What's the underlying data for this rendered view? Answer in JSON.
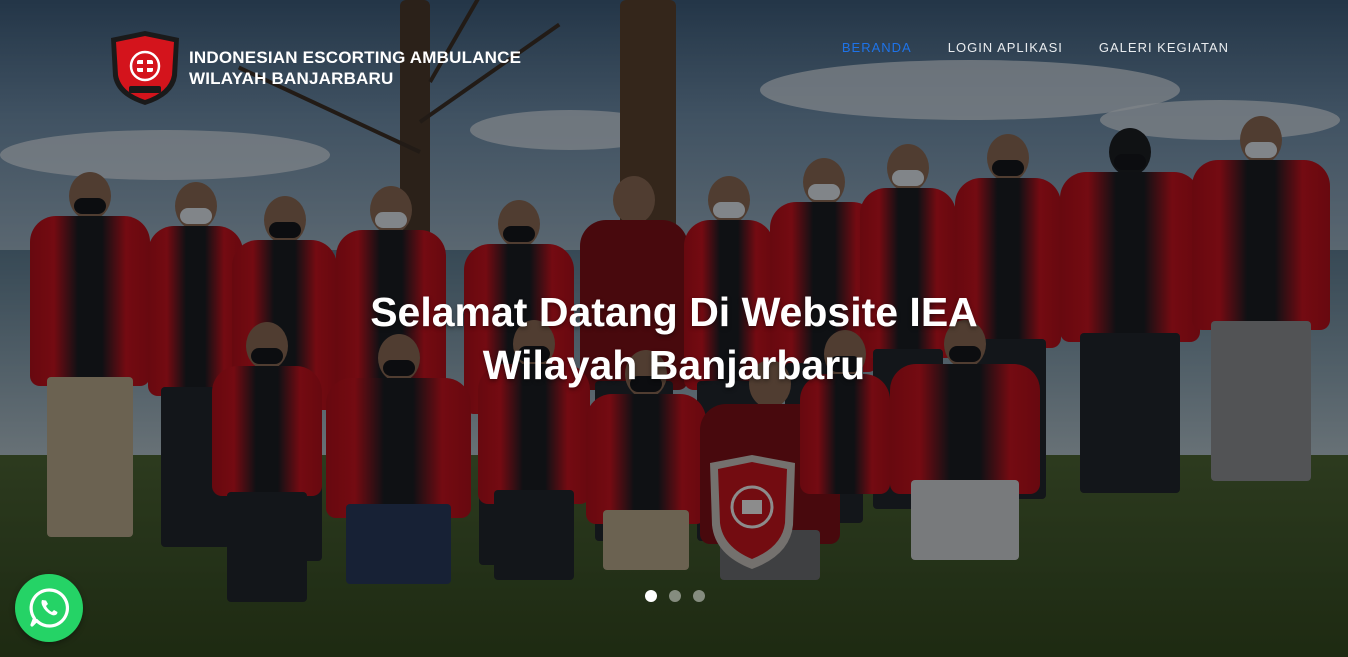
{
  "brand": {
    "line1": "INDONESIAN ESCORTING AMBULANCE",
    "line2": "WILAYAH BANJARBARU",
    "logo_icon": "iea-shield-logo-icon",
    "logo_color": "#d4141c"
  },
  "nav": {
    "items": [
      {
        "label": "BERANDA",
        "active": true
      },
      {
        "label": "LOGIN APLIKASI",
        "active": false
      },
      {
        "label": "GALERI KEGIATAN",
        "active": false
      }
    ],
    "active_color": "#1e73e8"
  },
  "hero": {
    "title_line1": "Selamat Datang Di Website IEA",
    "title_line2": "Wilayah Banjarbaru",
    "background": "group photo of IEA members in red jackets on a beach",
    "slides_total": 3,
    "active_slide": 1
  },
  "whatsapp": {
    "icon": "whatsapp-icon",
    "color": "#25d366"
  }
}
